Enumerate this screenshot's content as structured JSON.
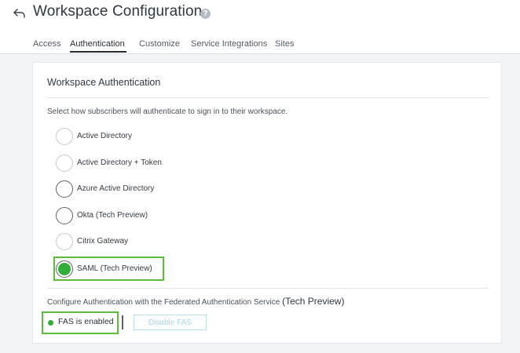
{
  "header": {
    "title": "Workspace Configuration",
    "back_icon": "back-arrow-icon",
    "help_icon": "help-icon",
    "help_glyph": "?"
  },
  "tabs": [
    {
      "label": "Access",
      "active": false
    },
    {
      "label": "Authentication",
      "active": true
    },
    {
      "label": "Customize",
      "active": false
    },
    {
      "label": "Service Integrations",
      "active": false
    },
    {
      "label": "Sites",
      "active": false
    }
  ],
  "auth_card": {
    "title": "Workspace Authentication",
    "description": "Select how subscribers will authenticate to sign in to their workspace.",
    "options": [
      {
        "label": "Active Directory",
        "selected": false
      },
      {
        "label": "Active Directory + Token",
        "selected": false
      },
      {
        "label": "Azure Active Directory",
        "selected": false
      },
      {
        "label": "Okta (Tech Preview)",
        "selected": false
      },
      {
        "label": "Citrix Gateway",
        "selected": false
      },
      {
        "label": "SAML (Tech Preview)",
        "selected": true
      }
    ]
  },
  "fas": {
    "label": "Configure Authentication with the Federated Authentication Service",
    "label_suffix": "(Tech Preview)",
    "status_text": "FAS is enabled",
    "disable_button": "Disable FAS"
  },
  "colors": {
    "accent_green": "#2fae38",
    "highlight_green": "#5cbc3a",
    "disabled_button_text": "#a9d2ea"
  }
}
